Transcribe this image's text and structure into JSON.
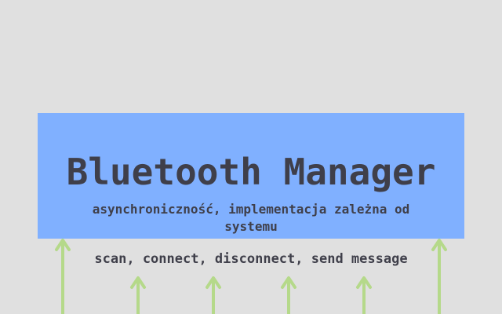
{
  "diagram": {
    "title": "Bluetooth Manager",
    "subtitle": "asynchroniczność, implementacja zależna od systemu",
    "operations": "scan, connect, disconnect, send message"
  },
  "colors": {
    "background": "#e0e0e0",
    "box": "#80b0ff",
    "text": "#3f3f4a",
    "arrow": "#b5d98a"
  }
}
